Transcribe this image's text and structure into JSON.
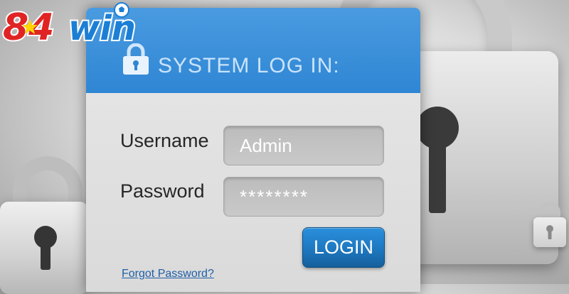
{
  "brand": {
    "logo_text": "84win",
    "colors": {
      "number_red": "#e02424",
      "star_yellow": "#ffd400",
      "win_blue": "#1b7fd6",
      "outline_white": "#ffffff"
    }
  },
  "background": {
    "icons": [
      "padlock-icon",
      "padlock-icon",
      "padlock-icon"
    ]
  },
  "login": {
    "header_icon": "padlock-icon",
    "title": "SYSTEM LOG IN:",
    "username_label": "Username",
    "username_value": "Admin",
    "password_label": "Password",
    "password_value": "********",
    "login_button": "LOGIN",
    "forgot_password": "Forgot Password?",
    "colors": {
      "header_blue": "#2f86d4",
      "button_blue": "#1e78c0",
      "link_blue": "#1f5fa8"
    }
  }
}
